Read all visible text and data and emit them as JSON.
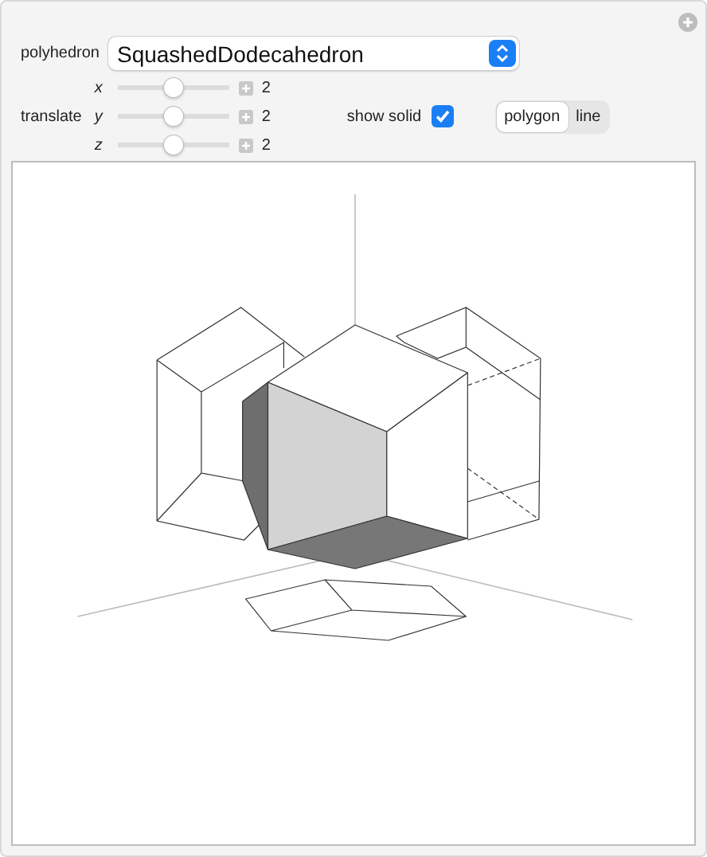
{
  "polyhedron": {
    "label": "polyhedron",
    "value": "SquashedDodecahedron"
  },
  "translate": {
    "label": "translate",
    "sliders": [
      {
        "axis": "x",
        "level": 0.5,
        "reading": "2"
      },
      {
        "axis": "y",
        "level": 0.5,
        "reading": "2"
      },
      {
        "axis": "z",
        "level": 0.5,
        "reading": "2"
      }
    ]
  },
  "show_solid": {
    "label": "show solid",
    "checked": true
  },
  "style": [
    {
      "label": "polygon",
      "selected": true
    },
    {
      "label": "line",
      "selected": false
    }
  ]
}
